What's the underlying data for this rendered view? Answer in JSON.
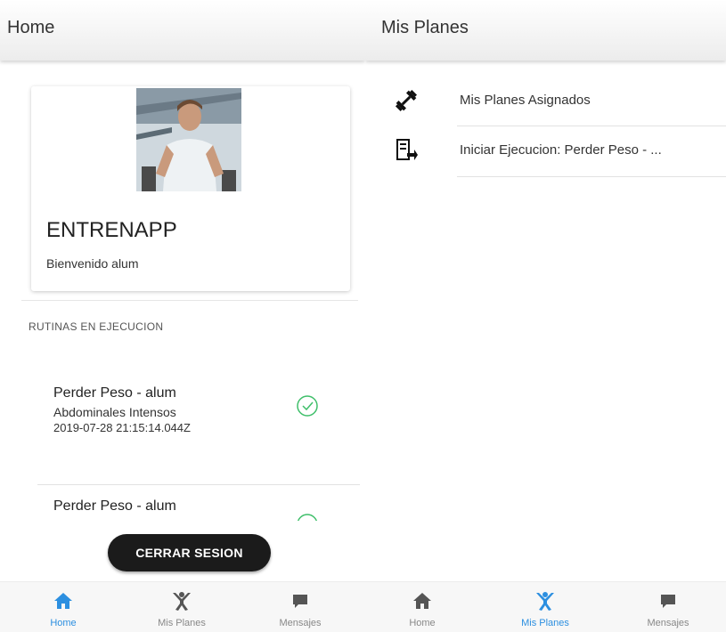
{
  "home": {
    "appbar_title": "Home",
    "card": {
      "title": "ENTRENAPP",
      "subtitle": "Bienvenido alum"
    },
    "section_header": "RUTINAS EN EJECUCION",
    "routines": [
      {
        "name": "Perder Peso - alum",
        "exercise": "Abdominales Intensos",
        "date": "2019-07-28 21:15:14.044Z",
        "status_icon": "check-circle-icon"
      },
      {
        "name": "Perder Peso - alum",
        "exercise": "",
        "date": "",
        "status_icon": "check-circle-icon"
      }
    ],
    "logout_label": "CERRAR SESION",
    "nav": [
      {
        "label": "Home",
        "icon": "home-icon",
        "active": true
      },
      {
        "label": "Mis Planes",
        "icon": "workout-figure-icon",
        "active": false
      },
      {
        "label": "Mensajes",
        "icon": "chat-icon",
        "active": false
      }
    ]
  },
  "plans": {
    "appbar_title": "Mis Planes",
    "items": [
      {
        "label": "Mis Planes Asignados",
        "icon": "dumbbell-icon"
      },
      {
        "label": "Iniciar Ejecucion: Perder Peso - ...",
        "icon": "clipboard-run-icon"
      }
    ],
    "nav": [
      {
        "label": "Home",
        "icon": "home-icon",
        "active": false
      },
      {
        "label": "Mis Planes",
        "icon": "workout-figure-icon",
        "active": true
      },
      {
        "label": "Mensajes",
        "icon": "chat-icon",
        "active": false
      }
    ]
  },
  "colors": {
    "accent": "#2c8fe0",
    "check_green": "#3fbf6a",
    "logout_bg": "#1b1b1b",
    "inactive_icon": "#555555"
  }
}
